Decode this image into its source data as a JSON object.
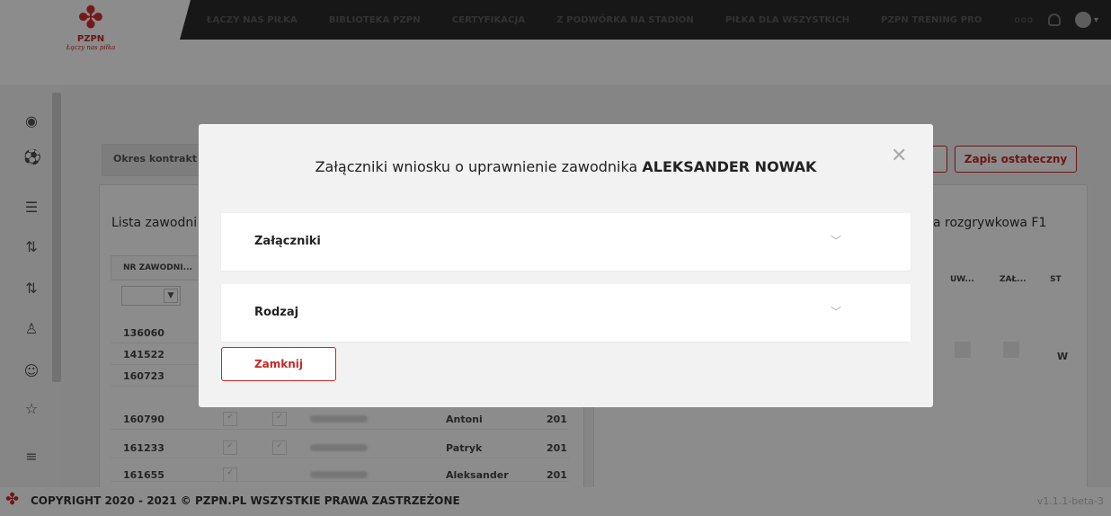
{
  "header": {
    "logo_text": "PZPN",
    "logo_tagline": "Łączy nas piłka",
    "nav_items": [
      "ŁĄCZY NAS PIŁKA",
      "BIBLIOTEKA PZPN",
      "CERTYFIKACJA",
      "Z PODWÓRKA NA STADION",
      "PIŁKA DLA WSZYSTKICH",
      "PZPN TRENING PRO"
    ],
    "more_icon": "ooo"
  },
  "background": {
    "tab_label": "Okres kontrakt",
    "list_title": "Lista zawodni",
    "right_title": "a rozgrywkowa F1",
    "col_nr": "NR ZAWODNI...",
    "right_cols": [
      "UW...",
      "ZAŁ...",
      "ST"
    ],
    "right_w": "W",
    "save_final": "Zapis ostateczny",
    "rows": [
      {
        "nr": "136060",
        "first": "",
        "yr": ""
      },
      {
        "nr": "141522",
        "first": "",
        "yr": ""
      },
      {
        "nr": "160723",
        "first": "",
        "yr": ""
      },
      {
        "nr": "160790",
        "first": "Antoni",
        "yr": "201"
      },
      {
        "nr": "161233",
        "first": "Patryk",
        "yr": "201"
      },
      {
        "nr": "161655",
        "first": "Aleksander",
        "yr": "201"
      }
    ]
  },
  "footer": {
    "copyright": "COPYRIGHT 2020 - 2021 © PZPN.PL WSZYSTKIE PRAWA ZASTRZEŻONE",
    "version": "v1.1.1-beta-3"
  },
  "modal": {
    "title_prefix": "Załączniki wniosku o uprawnienie zawodnika",
    "player_name": "ALEKSANDER NOWAK",
    "sections": [
      "Załączniki",
      "Rodzaj"
    ],
    "close_button": "Zamknij"
  },
  "colors": {
    "accent": "#c62828",
    "navbar": "#2b2b2b"
  }
}
